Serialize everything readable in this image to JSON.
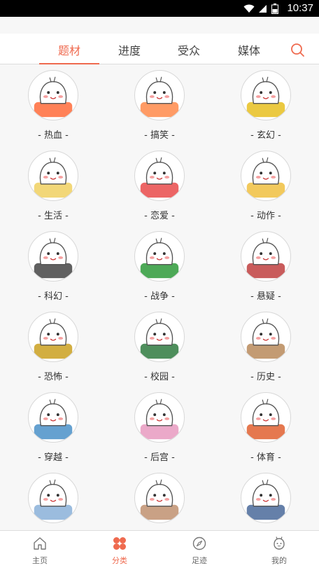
{
  "status_bar": {
    "time": "10:37"
  },
  "tabs": [
    {
      "label": "题材",
      "active": true
    },
    {
      "label": "进度",
      "active": false
    },
    {
      "label": "受众",
      "active": false
    },
    {
      "label": "媒体",
      "active": false
    }
  ],
  "search_icon": "search-icon",
  "categories": [
    {
      "label": "- 热血 -",
      "color": "#ff6b3a"
    },
    {
      "label": "- 搞笑 -",
      "color": "#ff8a4a"
    },
    {
      "label": "- 玄幻 -",
      "color": "#e8c020"
    },
    {
      "label": "- 生活 -",
      "color": "#f0d060"
    },
    {
      "label": "- 恋爱 -",
      "color": "#e94a4a"
    },
    {
      "label": "- 动作 -",
      "color": "#f0c040"
    },
    {
      "label": "- 科幻 -",
      "color": "#444444"
    },
    {
      "label": "- 战争 -",
      "color": "#2e9a3a"
    },
    {
      "label": "- 悬疑 -",
      "color": "#c04040"
    },
    {
      "label": "- 恐怖 -",
      "color": "#caa020"
    },
    {
      "label": "- 校园 -",
      "color": "#2f7a3f"
    },
    {
      "label": "- 历史 -",
      "color": "#b88a5a"
    },
    {
      "label": "- 穿越 -",
      "color": "#4a90c8"
    },
    {
      "label": "- 后宫 -",
      "color": "#e89ac0"
    },
    {
      "label": "- 体育 -",
      "color": "#e06030"
    },
    {
      "label": "",
      "color": "#8ab0d8"
    },
    {
      "label": "",
      "color": "#c09070"
    },
    {
      "label": "",
      "color": "#4a6a9a"
    }
  ],
  "bottom_nav": [
    {
      "label": "主页",
      "icon": "home-icon",
      "active": false
    },
    {
      "label": "分类",
      "icon": "category-icon",
      "active": true
    },
    {
      "label": "足迹",
      "icon": "compass-icon",
      "active": false
    },
    {
      "label": "我的",
      "icon": "profile-icon",
      "active": false
    }
  ],
  "colors": {
    "accent": "#ef6a4f"
  }
}
